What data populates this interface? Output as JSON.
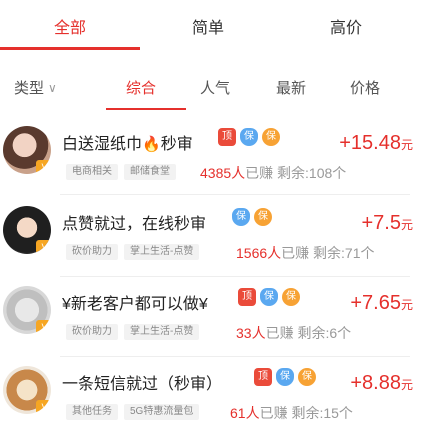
{
  "top_tabs": [
    {
      "label": "全部",
      "active": true
    },
    {
      "label": "简单",
      "active": false
    },
    {
      "label": "高价",
      "active": false
    }
  ],
  "filter": {
    "type_label": "类型",
    "sort_tabs": [
      {
        "label": "综合",
        "active": true
      },
      {
        "label": "人气",
        "active": false
      },
      {
        "label": "最新",
        "active": false
      },
      {
        "label": "价格",
        "active": false
      }
    ]
  },
  "tasks": [
    {
      "title": "白送湿纸巾",
      "title_suffix": "秒审",
      "has_fire": true,
      "price": "+15.48",
      "unit": "元",
      "tags": [
        "电商相关",
        "邮储食堂"
      ],
      "earned_count": "4385人",
      "earned_label": "已赚",
      "remaining": "剩余:108个",
      "icons": [
        "top-icon",
        "shield-icon",
        "orange-badge-icon"
      ],
      "accent_color": "#e5302c"
    },
    {
      "title": "点赞就过，在线秒审",
      "title_suffix": "",
      "has_fire": false,
      "price": "+7.5",
      "unit": "元",
      "tags": [
        "砍价助力",
        "掌上生活-点赞"
      ],
      "earned_count": "1566人",
      "earned_label": "已赚",
      "remaining": "剩余:71个",
      "icons": [
        "shield-icon",
        "orange-badge-icon"
      ],
      "accent_color": "#e5302c"
    },
    {
      "title": "¥新老客户都可以做¥",
      "title_suffix": "",
      "has_fire": false,
      "price": "+7.65",
      "unit": "元",
      "tags": [
        "砍价助力",
        "掌上生活-点赞"
      ],
      "earned_count": "33人",
      "earned_label": "已赚",
      "remaining": "剩余:6个",
      "icons": [
        "top-icon",
        "shield-icon",
        "orange-badge-icon"
      ],
      "accent_color": "#e5302c"
    },
    {
      "title": "一条短信就过（秒审）",
      "title_suffix": "",
      "has_fire": false,
      "price": "+8.88",
      "unit": "元",
      "tags": [
        "其他任务",
        "5G特惠流量包"
      ],
      "earned_count": "61人",
      "earned_label": "已赚",
      "remaining": "剩余:15个",
      "icons": [
        "top-icon",
        "shield-icon",
        "orange-badge-icon"
      ],
      "accent_color": "#e5302c"
    }
  ],
  "icon_texts": {
    "top": "顶",
    "shield": "保",
    "orange": "保",
    "fire": "🔥",
    "chevron": "∨",
    "vip": "V"
  }
}
